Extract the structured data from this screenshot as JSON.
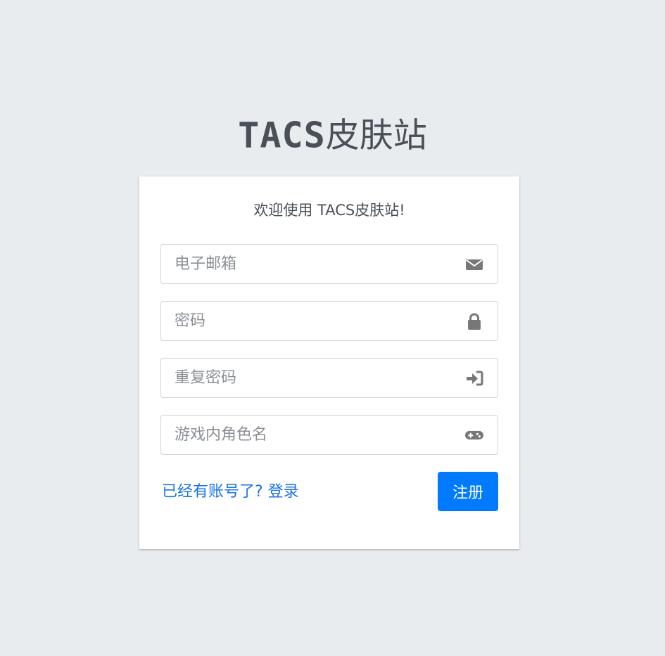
{
  "brand": {
    "logo_text": "TACS",
    "suffix": "皮肤站"
  },
  "card": {
    "welcome": "欢迎使用 TACS皮肤站!",
    "fields": {
      "email": {
        "placeholder": "电子邮箱",
        "value": "",
        "icon": "envelope-icon"
      },
      "password": {
        "placeholder": "密码",
        "value": "",
        "icon": "lock-icon"
      },
      "confirm_password": {
        "placeholder": "重复密码",
        "value": "",
        "icon": "sign-in-icon"
      },
      "player_name": {
        "placeholder": "游戏内角色名",
        "value": "",
        "icon": "gamepad-icon"
      }
    },
    "login_link": "已经有账号了? 登录",
    "register_button": "注册"
  },
  "colors": {
    "background": "#e9ecef",
    "primary": "#007bff",
    "link": "#1a73e8",
    "icon": "#777777"
  }
}
